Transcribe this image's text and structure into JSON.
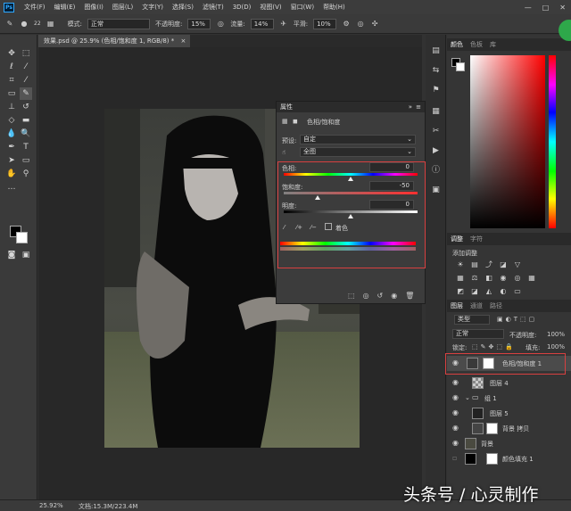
{
  "menubar": {
    "logo": "Ps",
    "items": [
      "文件(F)",
      "编辑(E)",
      "图像(I)",
      "图层(L)",
      "文字(Y)",
      "选择(S)",
      "滤镜(T)",
      "3D(D)",
      "视图(V)",
      "窗口(W)",
      "帮助(H)"
    ],
    "controls": [
      "—",
      "□",
      "✕"
    ]
  },
  "options": {
    "brush_size": "22",
    "mode_label": "模式:",
    "mode_value": "正常",
    "opacity_label": "不透明度:",
    "opacity_value": "15%",
    "flow_label": "流量:",
    "flow_value": "14%",
    "smooth_label": "平滑:",
    "smooth_value": "10%"
  },
  "document": {
    "tab_title": "效果.psd @ 25.9% (色相/饱和度 1, RGB/8) *",
    "tab_close": "×"
  },
  "properties": {
    "header": "属性",
    "panel_title": "色相/饱和度",
    "preset_label": "预设:",
    "preset_value": "自定",
    "channel_value": "全图",
    "hue_label": "色相:",
    "hue_value": 0,
    "saturation_label": "饱和度:",
    "saturation_value": -50,
    "lightness_label": "明度:",
    "lightness_value": 0,
    "colorize_label": "着色"
  },
  "right_panel": {
    "color_tabs": [
      "颜色",
      "色板",
      "库"
    ],
    "adjust_tabs": [
      "调整",
      "字符"
    ],
    "adjust_title": "添加调整",
    "layers_tabs": [
      "图层",
      "通道",
      "路径"
    ],
    "filter_kind": "类型",
    "blend_mode": "正常",
    "opacity_label": "不透明度:",
    "opacity_value": "100%",
    "lock_label": "锁定:",
    "fill_label": "填充:",
    "fill_value": "100%",
    "layers": [
      {
        "name": "色相/饱和度 1",
        "selected": true
      },
      {
        "name": "图层 4",
        "selected": false
      },
      {
        "name": "组 1",
        "selected": false
      },
      {
        "name": "图层 5",
        "selected": false
      },
      {
        "name": "背景 拷贝",
        "selected": false
      },
      {
        "name": "背景",
        "selected": false
      },
      {
        "name": "颜色填充 1",
        "selected": false
      }
    ]
  },
  "status": {
    "zoom": "25.92%",
    "doc_info": "文档:15.3M/223.4M"
  },
  "watermark": "头条号 / 心灵制作",
  "colors": {
    "accent_red": "#d84040",
    "selection_blue": "#4b4b4b"
  }
}
